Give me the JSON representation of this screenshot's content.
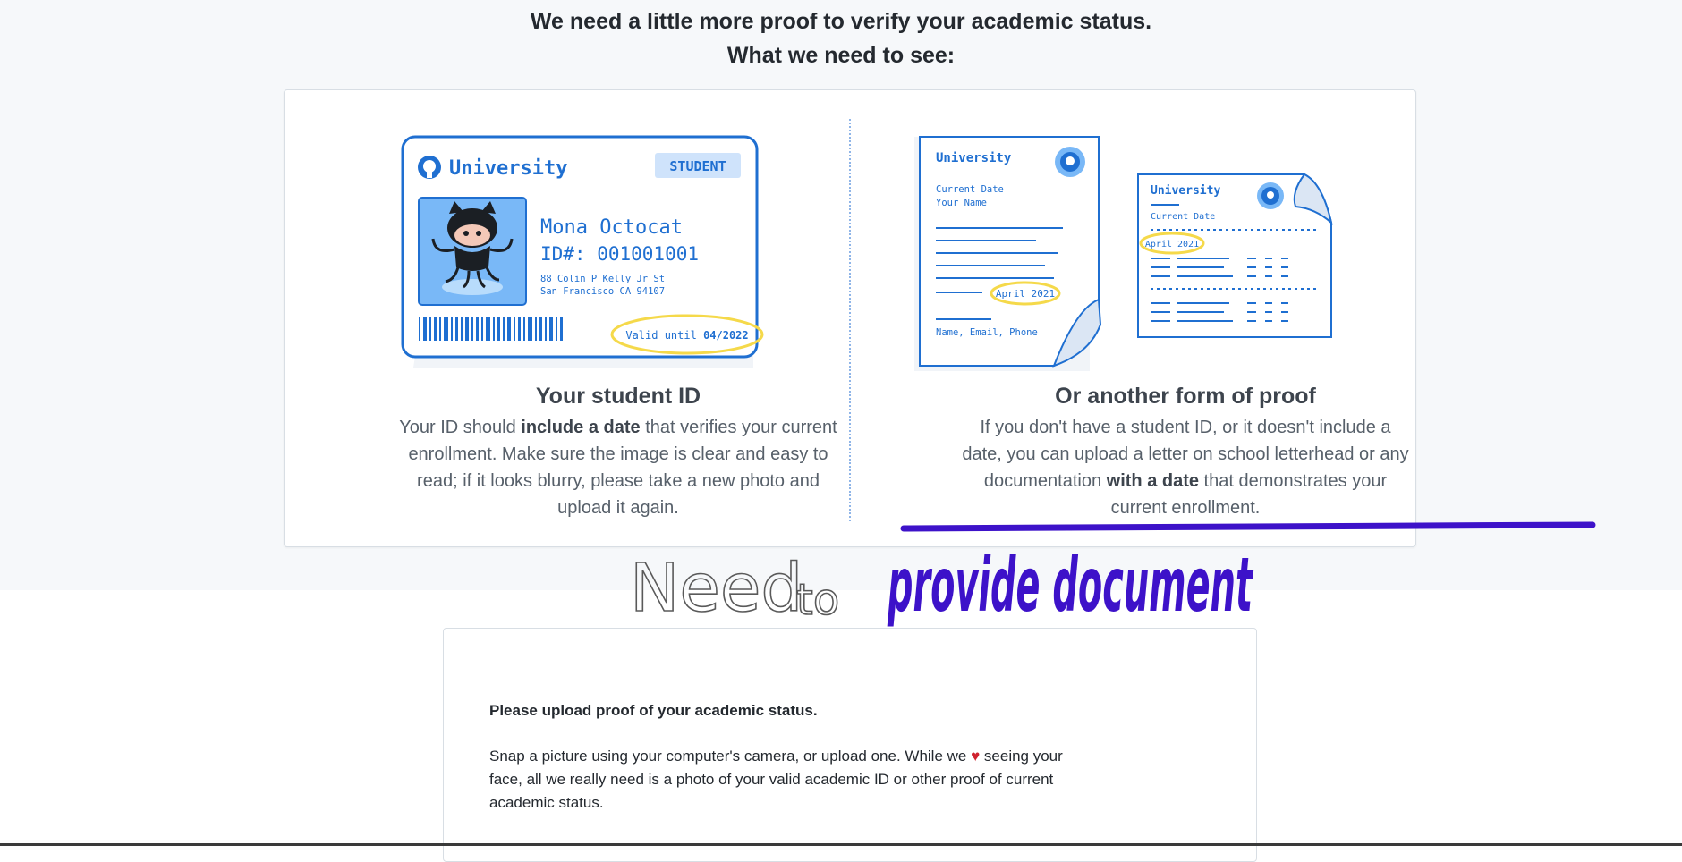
{
  "header": {
    "line1": "We need a little more proof to verify your academic status.",
    "line2": "What we need to see:"
  },
  "left": {
    "title": "Your student ID",
    "desc_a": "Your ID should ",
    "desc_bold": "include a date",
    "desc_b": " that verifies your current enrollment. Make sure the image is clear and easy to read; if it looks blurry, please take a new photo and upload it again.",
    "card": {
      "university": "University",
      "badge": "STUDENT",
      "name": "Mona Octocat",
      "id": "ID#: 001001001",
      "address1": "88 Colin P Kelly Jr St",
      "address2": "San Francisco CA 94107",
      "valid_prefix": "Valid until ",
      "valid_date": "04/2022"
    }
  },
  "right": {
    "title": "Or another form of proof",
    "desc_a": "If you don't have a student ID, or it doesn't include a date, you can upload a letter on school letterhead or any documentation ",
    "desc_bold": "with a date",
    "desc_b": " that demonstrates your current enrollment.",
    "doc1": {
      "university": "University",
      "current_date": "Current Date",
      "your_name": "Your Name",
      "date_value": "April 2021",
      "footer": "Name, Email, Phone"
    },
    "doc2": {
      "university": "University",
      "current_date": "Current Date",
      "date_value": "April 2021"
    }
  },
  "annotation": {
    "word1": "Need",
    "word2": "to",
    "phrase": "provide document"
  },
  "upload": {
    "title": "Please upload proof of your academic status.",
    "text_a": "Snap a picture using your computer's camera, or upload one. While we ",
    "heart": "♥",
    "text_b": " seeing your face, all we really need is a photo of your valid academic ID or other proof of current academic status."
  },
  "colors": {
    "accent": "#0969da",
    "highlight": "#f5d94a",
    "ink": "#3d12c9",
    "heart": "#cf222e"
  }
}
